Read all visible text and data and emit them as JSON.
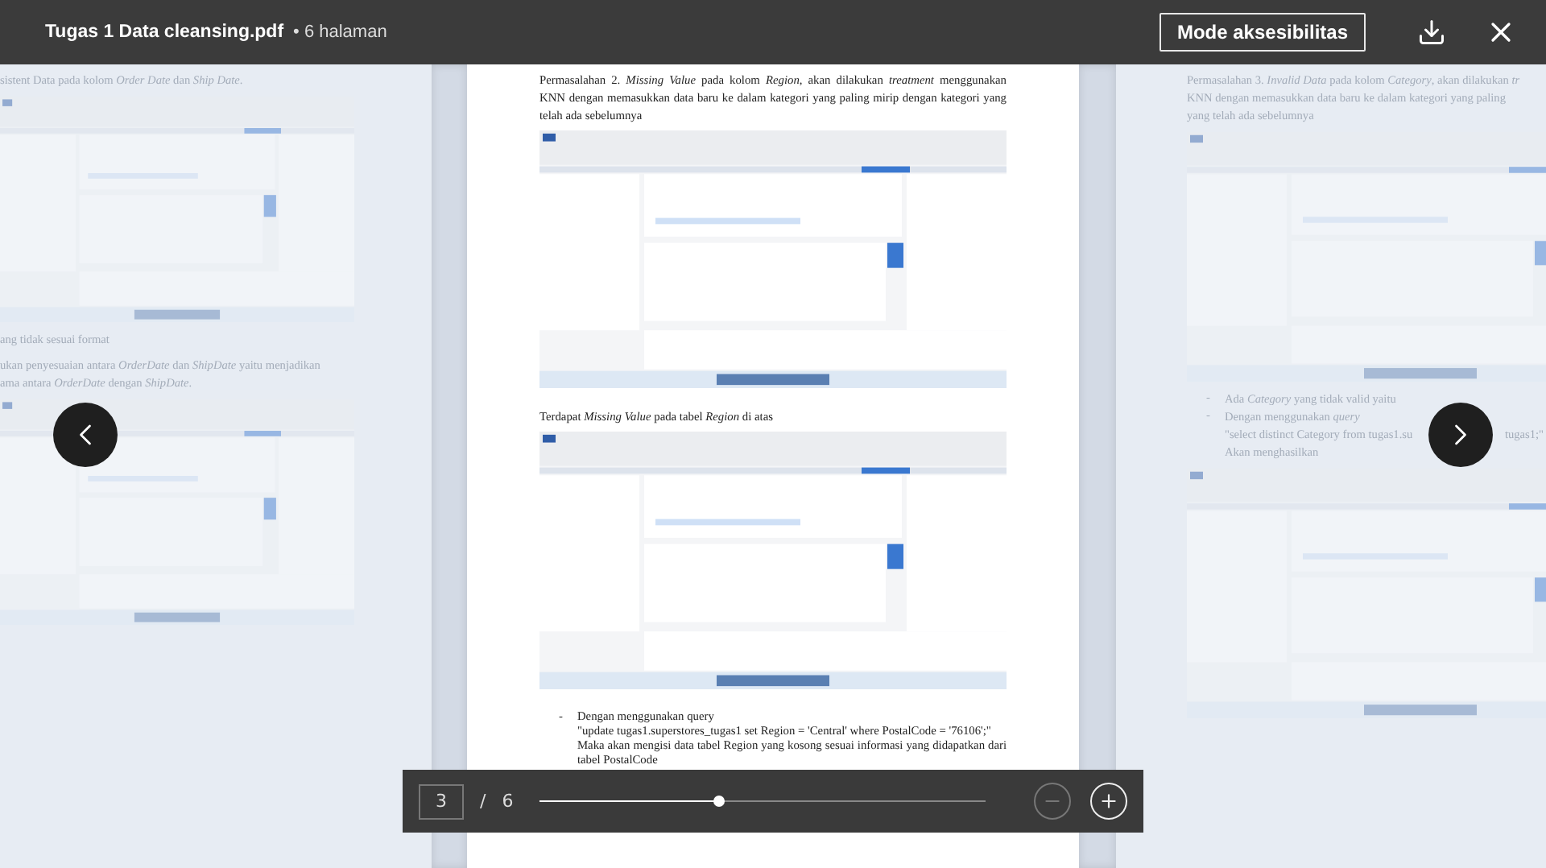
{
  "header": {
    "title": "Tugas 1 Data cleansing.pdf",
    "page_count": "• 6 halaman",
    "accessibility_button": "Mode aksesibilitas"
  },
  "pages": [
    {
      "kind": "side",
      "blocks": [
        {
          "kind": "lines",
          "lines": [
            [
              "sistent Data pada kolom *Order Date* dan *Ship Date*."
            ]
          ]
        },
        {
          "kind": "screenshot"
        },
        {
          "kind": "lines",
          "lines": [
            [
              "ang tidak sesuai format"
            ]
          ]
        },
        {
          "kind": "lines",
          "lines": [
            [
              "ukan penyesuaian antara *OrderDate* dan *ShipDate* yaitu menjadikan"
            ],
            [
              "ama antara *OrderDate* dengan *ShipDate*."
            ]
          ]
        },
        {
          "kind": "screenshot"
        }
      ]
    },
    {
      "kind": "current",
      "blocks": [
        {
          "kind": "paragraph",
          "text": "Permasalahan 2. *Missing Value* pada kolom *Region*, akan dilakukan *treatment* menggunakan KNN dengan memasukkan data baru ke dalam kategori yang paling mirip dengan kategori yang telah ada sebelumnya"
        },
        {
          "kind": "screenshot"
        },
        {
          "kind": "paragraph",
          "text": "Terdapat *Missing Value* pada tabel *Region* di atas"
        },
        {
          "kind": "screenshot"
        },
        {
          "kind": "list",
          "items": [
            {
              "bullet": "-",
              "lines": [
                [
                  "Dengan menggunakan query"
                ],
                [
                  "\"update tugas1.superstores_tugas1 set Region = 'Central' where PostalCode = '76106';\""
                ],
                [
                  "Maka akan mengisi data tabel Region yang kosong sesuai informasi yang didapatkan dari tabel PostalCode"
                ]
              ]
            }
          ]
        }
      ]
    },
    {
      "kind": "side",
      "blocks": [
        {
          "kind": "lines",
          "lines": [
            [
              "Permasalahan 3. *Invalid Data* pada kolom *Category*, akan dilakukan *tr*"
            ],
            [
              "KNN dengan memasukkan data baru ke dalam kategori yang paling"
            ],
            [
              "yang telah ada sebelumnya"
            ]
          ]
        },
        {
          "kind": "screenshot"
        },
        {
          "kind": "list",
          "items": [
            {
              "bullet": "-",
              "lines": [
                [
                  "Ada *Category* yang tidak valid yaitu"
                ]
              ]
            },
            {
              "bullet": "-",
              "lines": [
                [
                  "Dengan menggunakan *query*"
                ],
                [
                  "\"select distinct Category from tugas1.su",
                  "tugas1;\""
                ],
                [
                  "Akan menghasilkan"
                ]
              ]
            }
          ]
        },
        {
          "kind": "screenshot"
        }
      ]
    }
  ],
  "pager": {
    "page": "3",
    "separator": "/",
    "total": "6",
    "level": 0.4,
    "zoom_out": {
      "disabled": true
    },
    "zoom_in": {
      "disabled": false
    }
  }
}
